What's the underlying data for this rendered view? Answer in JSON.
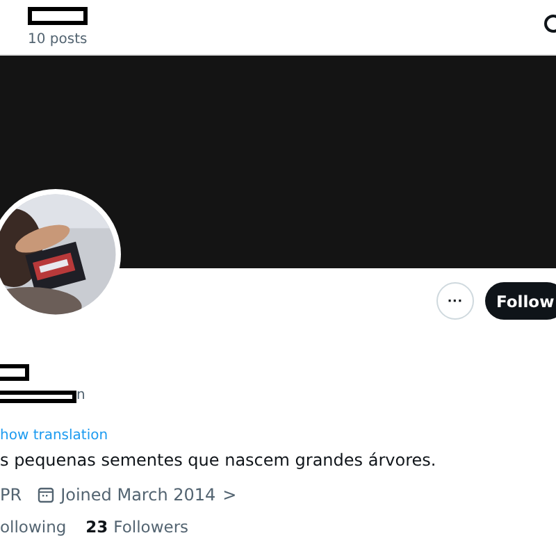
{
  "header": {
    "posts": "10 posts"
  },
  "profile": {
    "more_button": "···",
    "follow_button": "Follow",
    "handle_tail": "n",
    "translation_link": "how translation",
    "bio": "s pequenas sementes que nascem grandes árvores.",
    "location": "PR",
    "joined": "Joined March 2014",
    "joined_chevron": ">"
  },
  "stats": [
    {
      "label": "ollowing"
    },
    {
      "count": "23",
      "label": "Followers"
    }
  ]
}
